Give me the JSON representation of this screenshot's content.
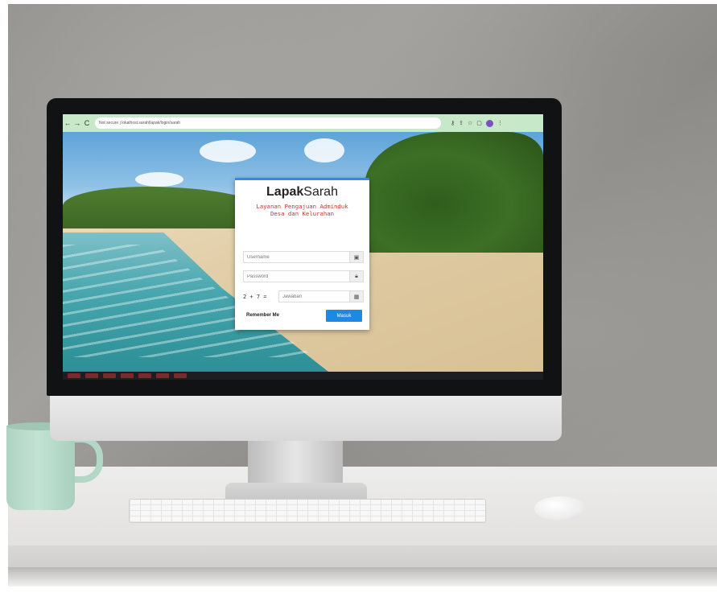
{
  "browser": {
    "url": "Not secure | lokalhost.sarah/lapak/login/sarah",
    "nav": {
      "back": "←",
      "forward": "→",
      "reload": "C"
    }
  },
  "login": {
    "brand_bold": "Lapak",
    "brand_regular": "Sarah",
    "tagline_line1": "Layanan Pengajuan Adminduk",
    "tagline_line2": "Desa dan Kelurahan",
    "username_placeholder": "Username",
    "password_placeholder": "Password",
    "captcha_question": "2 + 7 =",
    "captcha_placeholder": "Jawaban",
    "remember_label": "Remember Me",
    "submit_label": "Masuk"
  },
  "colors": {
    "accent": "#1e88e5",
    "tagline": "#c0392b",
    "browser_bar": "#c7e8c9"
  },
  "icons": {
    "username": "id-card-icon",
    "password": "lock-icon",
    "captcha": "grid-icon"
  }
}
